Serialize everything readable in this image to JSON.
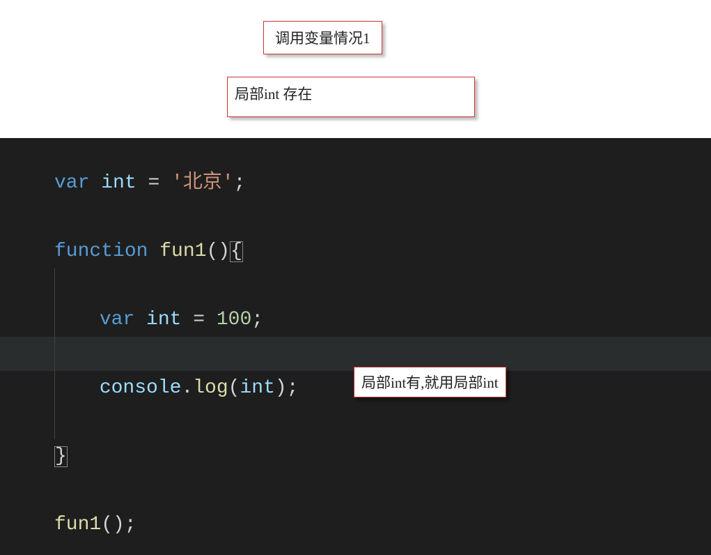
{
  "title_box": "调用变量情况1",
  "sub_box": "局部int 存在",
  "annotation": "局部int有,就用局部int",
  "code": {
    "line1": {
      "kw_var": "var ",
      "ident": "int ",
      "eq": "= ",
      "str": "'北京'",
      "semi": ";"
    },
    "line3": {
      "kw_func": "function ",
      "name": "fun1",
      "paren": "()",
      "brace": "{"
    },
    "line5": {
      "kw_var": "var ",
      "ident": "int ",
      "eq": "= ",
      "num": "100",
      "semi": ";"
    },
    "line7": {
      "console": "console",
      "dot": ".",
      "log": "log",
      "open": "(",
      "arg": "int",
      "close": ")",
      "semi": ";"
    },
    "line9": {
      "brace": "}"
    },
    "line11": {
      "call": "fun1",
      "paren": "()",
      "semi": ";"
    }
  }
}
